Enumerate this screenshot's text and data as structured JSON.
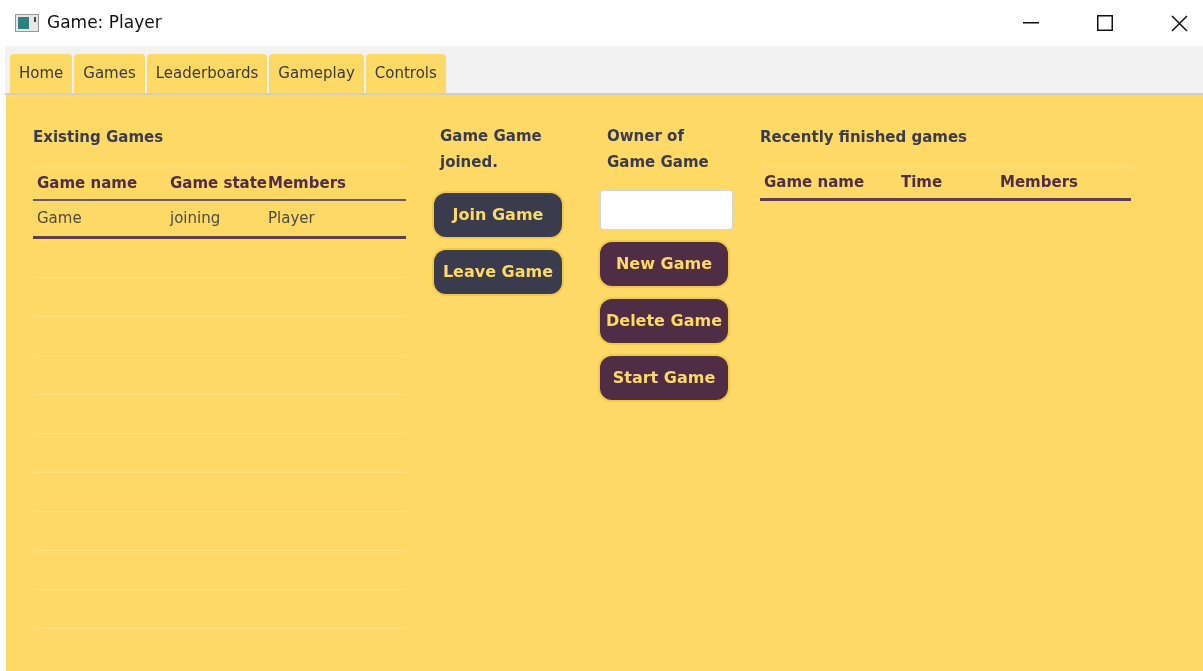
{
  "window": {
    "title": "Game: Player"
  },
  "tabs": [
    {
      "label": "Home"
    },
    {
      "label": "Games"
    },
    {
      "label": "Leaderboards"
    },
    {
      "label": "Gameplay"
    },
    {
      "label": "Controls"
    }
  ],
  "existing_games": {
    "title": "Existing Games",
    "columns": [
      "Game name",
      "Game state",
      "Members"
    ],
    "rows": [
      [
        "Game",
        "joining",
        "Player"
      ]
    ]
  },
  "joined": {
    "status": "Game Game joined.",
    "buttons": [
      "Join Game",
      "Leave Game"
    ]
  },
  "owner": {
    "status": "Owner of Game Game",
    "buttons": [
      "New Game",
      "Delete Game",
      "Start Game"
    ]
  },
  "finished_games": {
    "title": "Recently finished games",
    "columns": [
      "Game name",
      "Time",
      "Members"
    ]
  }
}
